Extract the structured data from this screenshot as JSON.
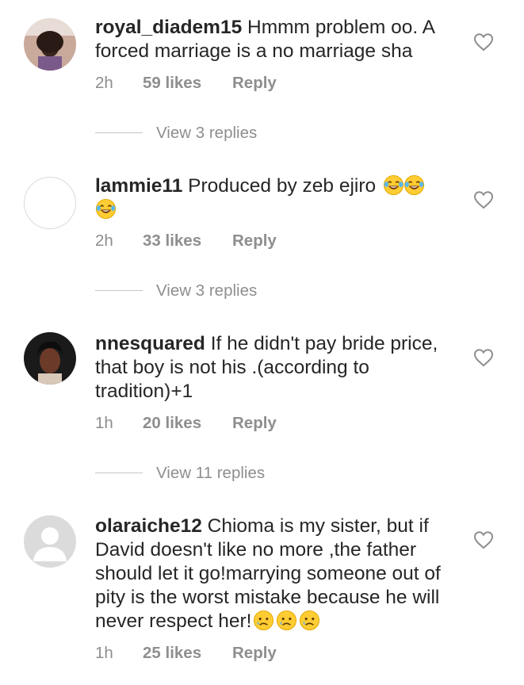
{
  "comments": [
    {
      "username": "royal_diadem15",
      "text": "Hmmm problem oo. A forced marriage is a no marriage sha",
      "time": "2h",
      "likes": "59 likes",
      "reply": "Reply",
      "view_replies": "View 3 replies",
      "emojis": []
    },
    {
      "username": "lammie11",
      "text": "Produced by zeb ejiro",
      "time": "2h",
      "likes": "33 likes",
      "reply": "Reply",
      "view_replies": "View 3 replies",
      "emojis": [
        "tears-of-joy",
        "tears-of-joy",
        "tears-of-joy"
      ]
    },
    {
      "username": "nnesquared",
      "text": "If he didn't pay bride price, that boy is not his .(according to tradition)+1",
      "time": "1h",
      "likes": "20 likes",
      "reply": "Reply",
      "view_replies": "View 11 replies",
      "emojis": []
    },
    {
      "username": "olaraiche12",
      "text": "Chioma is my sister, but if David doesn't like no more ,the father should let it go!marrying someone out of pity is the worst mistake because he will never respect her!",
      "time": "1h",
      "likes": "25 likes",
      "reply": "Reply",
      "emojis": [
        "sad-tear",
        "sad-tear",
        "sad-tear"
      ]
    }
  ],
  "icons": {
    "like": "heart-outline-icon",
    "default_avatar": "person-silhouette-icon"
  },
  "colors": {
    "text": "#262626",
    "meta": "#8e8e8e",
    "divider": "#c7c7c7",
    "emoji": "#ffcc33"
  }
}
